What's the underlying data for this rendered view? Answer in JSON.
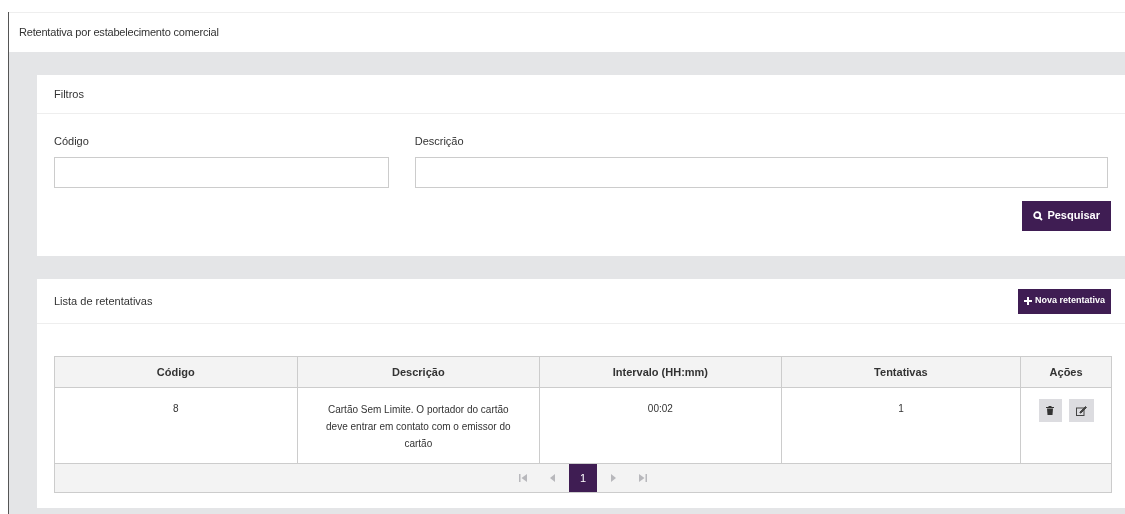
{
  "page_title": "Retentativa por estabelecimento comercial",
  "filters": {
    "title": "Filtros",
    "fields": [
      {
        "label": "Código"
      },
      {
        "label": "Descrição"
      }
    ],
    "search_button": "Pesquisar"
  },
  "list": {
    "title": "Lista de retentativas",
    "new_button": "Nova retentativa",
    "table": {
      "columns": [
        "Código",
        "Descrição",
        "Intervalo (HH:mm)",
        "Tentativas",
        "Ações"
      ],
      "rows": [
        {
          "codigo": "8",
          "descricao": "Cartão Sem Limite. O portador do cartão deve entrar em contato com o emissor do cartão",
          "intervalo": "00:02",
          "tentativas": "1"
        }
      ]
    },
    "pagination": {
      "first_disabled": true,
      "prev_disabled": true,
      "next_disabled": true,
      "last_disabled": true,
      "pages": [
        {
          "label": "1",
          "selected": true
        }
      ]
    }
  }
}
